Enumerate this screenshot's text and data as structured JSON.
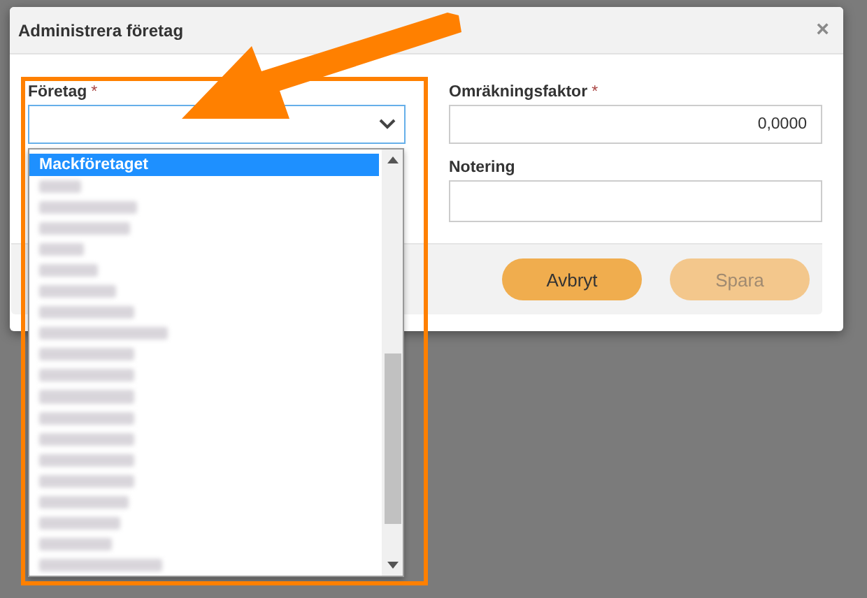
{
  "dialog": {
    "title": "Administrera företag",
    "close": "×"
  },
  "company_field": {
    "label": "Företag",
    "required_mark": "*",
    "expanded": true,
    "options": [
      {
        "label": "Mackföretaget",
        "selected": true
      }
    ]
  },
  "conversion_field": {
    "label": "Omräkningsfaktor",
    "required_mark": "*",
    "value": "0,0000"
  },
  "note_field": {
    "label": "Notering"
  },
  "buttons": [
    {
      "label": "Avbryt",
      "disabled": false
    },
    {
      "label": "Spara",
      "disabled": true
    }
  ]
}
